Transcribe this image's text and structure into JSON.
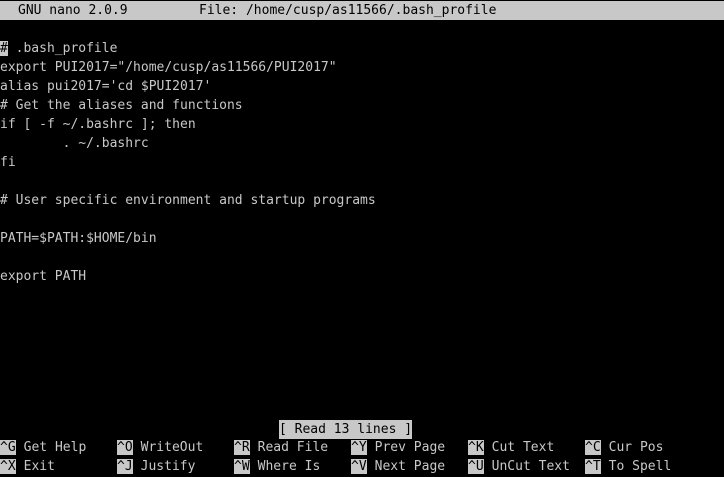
{
  "title_bar": {
    "app": "GNU nano 2.0.9",
    "file": "File: /home/cusp/as11566/.bash_profile"
  },
  "editor": {
    "cursor_char": "#",
    "lines": [
      " .bash_profile",
      "export PUI2017=\"/home/cusp/as11566/PUI2017\"",
      "alias pui2017='cd $PUI2017'",
      "# Get the aliases and functions",
      "if [ -f ~/.bashrc ]; then",
      "        . ~/.bashrc",
      "fi",
      "",
      "# User specific environment and startup programs",
      "",
      "PATH=$PATH:$HOME/bin",
      "",
      "export PATH"
    ]
  },
  "status_message": "[ Read 13 lines ]",
  "shortcuts": {
    "row1": [
      {
        "key": "^G",
        "label": "Get Help"
      },
      {
        "key": "^O",
        "label": "WriteOut"
      },
      {
        "key": "^R",
        "label": "Read File"
      },
      {
        "key": "^Y",
        "label": "Prev Page"
      },
      {
        "key": "^K",
        "label": "Cut Text"
      },
      {
        "key": "^C",
        "label": "Cur Pos"
      }
    ],
    "row2": [
      {
        "key": "^X",
        "label": "Exit"
      },
      {
        "key": "^J",
        "label": "Justify"
      },
      {
        "key": "^W",
        "label": "Where Is"
      },
      {
        "key": "^V",
        "label": "Next Page"
      },
      {
        "key": "^U",
        "label": "UnCut Text"
      },
      {
        "key": "^T",
        "label": "To Spell"
      }
    ]
  }
}
